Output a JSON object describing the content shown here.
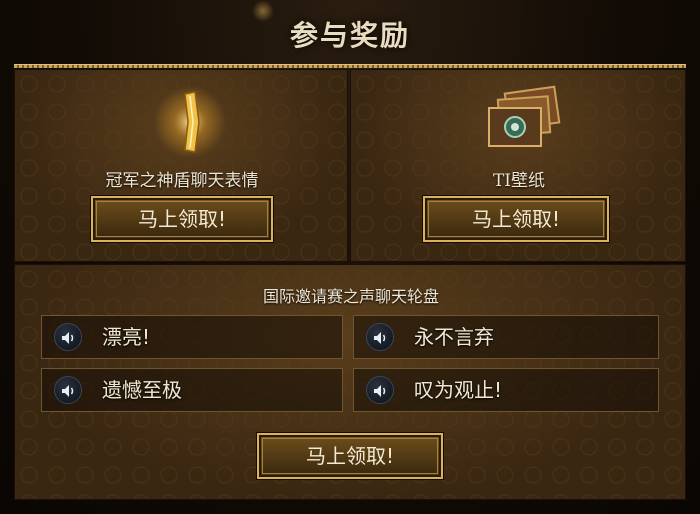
{
  "header": {
    "title": "参与奖励"
  },
  "rewards": [
    {
      "label": "冠军之神盾聊天表情",
      "button": "马上领取!",
      "icon": "golden-shield-icon"
    },
    {
      "label": "TI壁纸",
      "button": "马上领取!",
      "icon": "wallpaper-cards-icon"
    }
  ],
  "chat_wheel": {
    "title": "国际邀请赛之声聊天轮盘",
    "items": [
      {
        "text": "漂亮!",
        "icon": "speaker-icon"
      },
      {
        "text": "永不言弃",
        "icon": "speaker-icon"
      },
      {
        "text": "遗憾至极",
        "icon": "speaker-icon"
      },
      {
        "text": "叹为观止!",
        "icon": "speaker-icon"
      }
    ],
    "button": "马上领取!"
  },
  "colors": {
    "accent_gold": "#d9b25a",
    "panel_brown": "#3a2712",
    "text": "#efe6d2"
  }
}
